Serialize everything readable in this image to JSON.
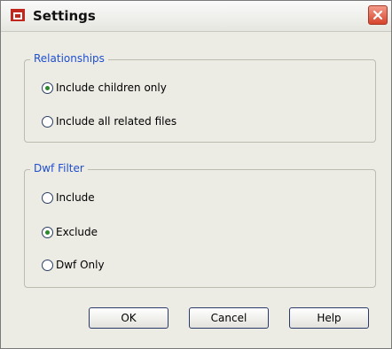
{
  "window": {
    "title": "Settings",
    "icons": {
      "app": "autodesk-app-icon",
      "close": "close-icon"
    },
    "colors": {
      "group_legend": "#1f4fd0",
      "close_button": "#d6442c",
      "radio_dot": "#2a8a2a"
    }
  },
  "relationships": {
    "legend": "Relationships",
    "options": [
      {
        "label": "Include children only",
        "checked": true
      },
      {
        "label": "Include all related files",
        "checked": false
      }
    ]
  },
  "dwf_filter": {
    "legend": "Dwf Filter",
    "options": [
      {
        "label": "Include",
        "checked": false
      },
      {
        "label": "Exclude",
        "checked": true
      },
      {
        "label": "Dwf Only",
        "checked": false
      }
    ]
  },
  "buttons": {
    "ok": "OK",
    "cancel": "Cancel",
    "help": "Help"
  }
}
